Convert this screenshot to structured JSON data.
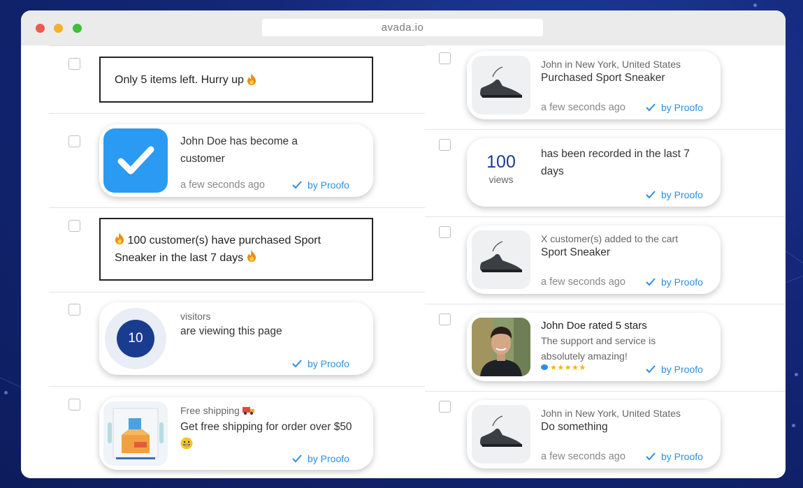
{
  "browser": {
    "url": "avada.io"
  },
  "left_column": {
    "text_notice_1": "Only 5 items left. Hurry up",
    "customer_card": {
      "title": "John Doe has become a customer",
      "time": "a few seconds ago",
      "badge": "by Proofo"
    },
    "text_notice_2": {
      "line1": "100 customer(s) have purchased Sport",
      "line2": "Sneaker in the last 7 days"
    },
    "visitors_card": {
      "count": "10",
      "label": "visitors",
      "text": "are viewing this page",
      "badge": "by Proofo"
    },
    "shipping_card": {
      "label": "Free shipping",
      "text": "Get free shipping for order over $50",
      "badge": "by Proofo"
    }
  },
  "right_column": {
    "purchase_card": {
      "location": "John in New York, United States",
      "text": "Purchased Sport Sneaker",
      "time": "a few seconds ago",
      "badge": "by Proofo"
    },
    "views_card": {
      "count": "100",
      "unit": "views",
      "text": "has been recorded in the last 7 days",
      "badge": "by Proofo"
    },
    "cart_card": {
      "label": "X customer(s) added to the cart",
      "text": "Sport Sneaker",
      "time": "a few seconds ago",
      "badge": "by Proofo"
    },
    "review_card": {
      "title": "John Doe rated 5 stars",
      "text": "The support and service is absolutely amazing!",
      "rating": 5,
      "stars": "★★★★★",
      "badge": "by Proofo"
    },
    "action_card": {
      "location": "John in New York, United States",
      "text": "Do something",
      "time": "a few seconds ago",
      "badge": "by Proofo"
    }
  },
  "colors": {
    "accent_blue": "#2d8ee0",
    "check_tile": "#2a9af3",
    "navy_circle": "#1a3c8f",
    "star": "#f5b400"
  }
}
